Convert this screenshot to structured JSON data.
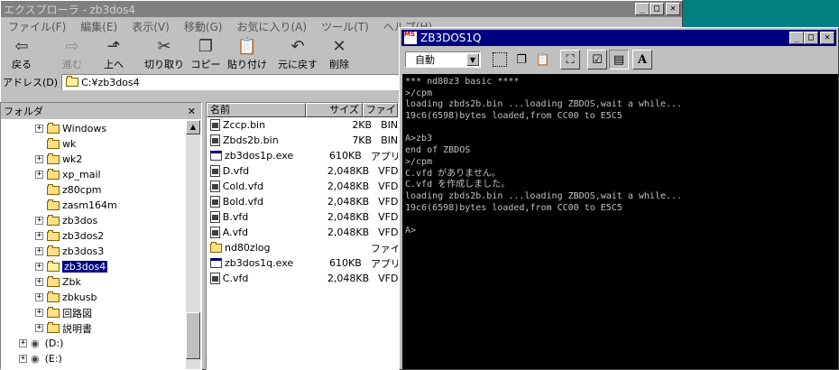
{
  "explorer": {
    "title": "エクスプローラ - zb3dos4",
    "menu": [
      "ファイル(F)",
      "編集(E)",
      "表示(V)",
      "移動(G)",
      "お気に入り(A)",
      "ツール(T)",
      "ヘルプ(H)"
    ],
    "toolbar": [
      {
        "label": "戻る",
        "icon": "arrow-left-icon",
        "glyph": "⇦",
        "enabled": true
      },
      {
        "label": "進む",
        "icon": "arrow-right-icon",
        "glyph": "⇨",
        "enabled": false
      },
      {
        "label": "上へ",
        "icon": "up-folder-icon",
        "glyph": "⬏",
        "enabled": true
      },
      {
        "label": "切り取り",
        "icon": "scissors-icon",
        "glyph": "✂",
        "enabled": true
      },
      {
        "label": "コピー",
        "icon": "copy-icon",
        "glyph": "❐",
        "enabled": true
      },
      {
        "label": "貼り付け",
        "icon": "paste-icon",
        "glyph": "📋",
        "enabled": true
      },
      {
        "label": "元に戻す",
        "icon": "undo-icon",
        "glyph": "↶",
        "enabled": true
      },
      {
        "label": "削除",
        "icon": "delete-icon",
        "glyph": "✕",
        "enabled": true
      }
    ],
    "address_label": "アドレス(D)",
    "address_value": "C:¥zb3dos4",
    "tree_header": "フォルダ",
    "tree": [
      {
        "label": "Windows",
        "plus": true
      },
      {
        "label": "wk",
        "plus": false
      },
      {
        "label": "wk2",
        "plus": true
      },
      {
        "label": "xp_mail",
        "plus": true
      },
      {
        "label": "z80cpm",
        "plus": false
      },
      {
        "label": "zasm164m",
        "plus": false
      },
      {
        "label": "zb3dos",
        "plus": true
      },
      {
        "label": "zb3dos2",
        "plus": true
      },
      {
        "label": "zb3dos3",
        "plus": true
      },
      {
        "label": "zb3dos4",
        "plus": true,
        "selected": true
      },
      {
        "label": "Zbk",
        "plus": true
      },
      {
        "label": "zbkusb",
        "plus": true
      },
      {
        "label": "回路図",
        "plus": true
      },
      {
        "label": "説明書",
        "plus": true
      }
    ],
    "drives": [
      {
        "label": "(D:)",
        "icon": "cd-drive-icon"
      },
      {
        "label": "(E:)",
        "icon": "cd-drive-icon"
      }
    ],
    "columns": [
      "名前",
      "サイズ",
      "ファイ"
    ],
    "files": [
      {
        "name": "Zccp.bin",
        "size": "2KB",
        "type": "BIN",
        "icon": "file-icon"
      },
      {
        "name": "Zbds2b.bin",
        "size": "7KB",
        "type": "BIN",
        "icon": "file-icon"
      },
      {
        "name": "zb3dos1p.exe",
        "size": "610KB",
        "type": "アプリ",
        "icon": "exe-icon"
      },
      {
        "name": "D.vfd",
        "size": "2,048KB",
        "type": "VFD",
        "icon": "file-icon"
      },
      {
        "name": "Cold.vfd",
        "size": "2,048KB",
        "type": "VFD",
        "icon": "file-icon"
      },
      {
        "name": "Bold.vfd",
        "size": "2,048KB",
        "type": "VFD",
        "icon": "file-icon"
      },
      {
        "name": "B.vfd",
        "size": "2,048KB",
        "type": "VFD",
        "icon": "file-icon"
      },
      {
        "name": "A.vfd",
        "size": "2,048KB",
        "type": "VFD",
        "icon": "file-icon"
      },
      {
        "name": "nd80zlog",
        "size": "",
        "type": "ファイ",
        "icon": "folder-icon"
      },
      {
        "name": "zb3dos1q.exe",
        "size": "610KB",
        "type": "アプリ",
        "icon": "exe-icon"
      },
      {
        "name": "C.vfd",
        "size": "2,048KB",
        "type": "VFD",
        "icon": "file-icon"
      }
    ]
  },
  "console": {
    "title": "ZB3DOS1Q",
    "app_icon_text": "MS",
    "font_select": "自動",
    "lines": [
      "*** nd80z3 basic ****",
      ">/cpm",
      "loading zbds2b.bin ...loading ZBDOS,wait a while...",
      "19c6(6598)bytes loaded,from CC00 to E5C5",
      "",
      "A>zb3",
      "end of ZBDOS",
      ">/cpm",
      "C.vfd がありません。",
      "C.vfd を作成しました。",
      "loading zbds2b.bin ...loading ZBDOS,wait a while...",
      "19c6(6598)bytes loaded,from CC00 to E5C5",
      "",
      "A>"
    ]
  }
}
